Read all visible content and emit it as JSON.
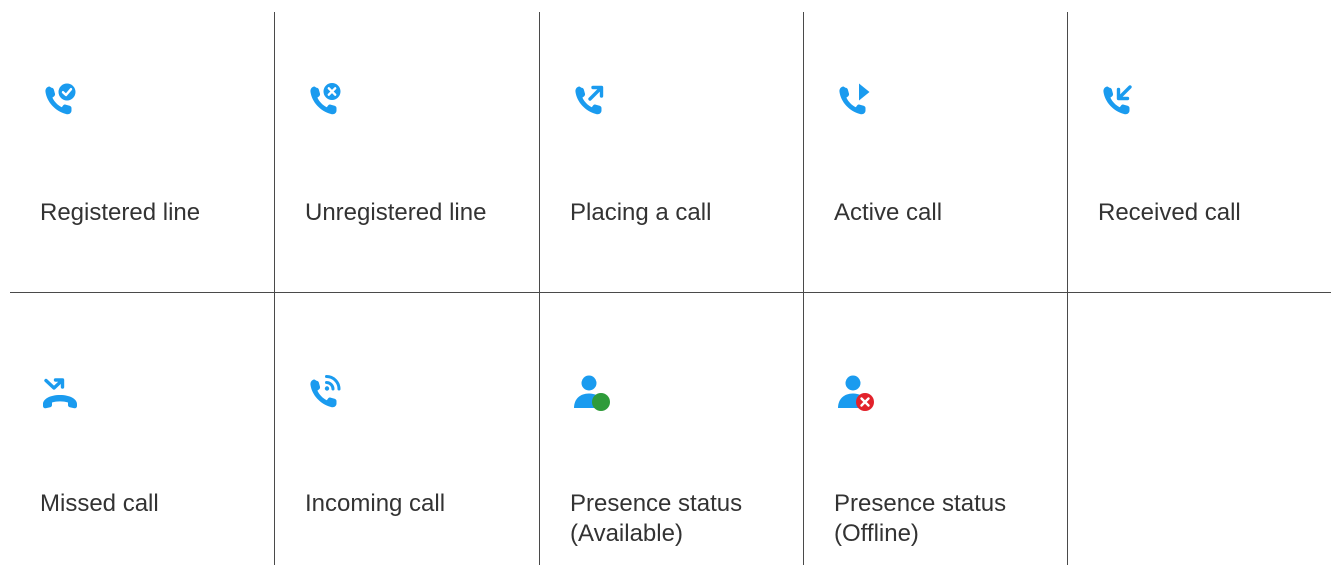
{
  "colors": {
    "icon_blue": "#1a9bef",
    "available_green": "#2e9b3a",
    "offline_red": "#e2222b",
    "divider": "#4a4a4a",
    "text": "#333333"
  },
  "rows": [
    {
      "cells": [
        {
          "icon": "phone-check-icon",
          "label": "Registered line"
        },
        {
          "icon": "phone-x-icon",
          "label": "Unregistered line"
        },
        {
          "icon": "phone-outgoing-icon",
          "label": "Placing a call"
        },
        {
          "icon": "phone-play-icon",
          "label": "Active call"
        },
        {
          "icon": "phone-incoming-icon",
          "label": "Received call"
        }
      ]
    },
    {
      "cells": [
        {
          "icon": "phone-missed-icon",
          "label": "Missed call"
        },
        {
          "icon": "phone-ringing-icon",
          "label": "Incoming call"
        },
        {
          "icon": "user-available-icon",
          "label_line1": "Presence status",
          "label_line2": "(Available)"
        },
        {
          "icon": "user-offline-icon",
          "label_line1": "Presence status",
          "label_line2": "(Offline)"
        },
        {}
      ]
    }
  ]
}
